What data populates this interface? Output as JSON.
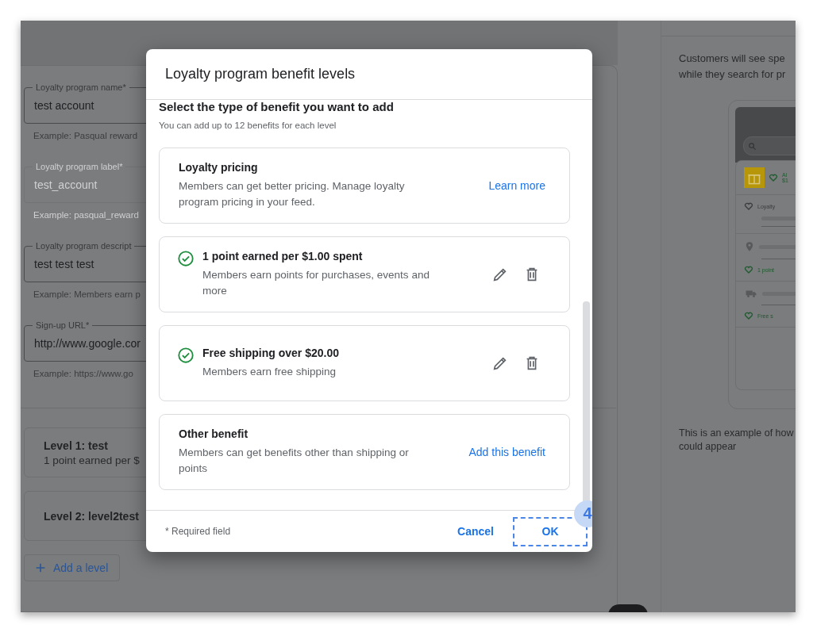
{
  "form": {
    "fields": [
      {
        "label": "Loyalty program name*",
        "value": "test account",
        "hint": "Example: Pasqual reward",
        "disabled": false
      },
      {
        "label": "Loyalty program label*",
        "value": "test_account",
        "hint": "Example: pasqual_reward",
        "disabled": true
      },
      {
        "label": "Loyalty program descript",
        "value": "test test test",
        "hint": "Example: Members earn p",
        "disabled": false
      },
      {
        "label": "Sign-up URL*",
        "value": "http://www.google.cor",
        "hint": "Example: https://www.go",
        "disabled": false
      }
    ],
    "levels": [
      {
        "title": "Level 1: test",
        "subtitle": "1 point earned per $"
      },
      {
        "title": "Level 2: level2test"
      }
    ],
    "add_level": "Add a level"
  },
  "preview": {
    "intro": "Customers will see spe while they search for pr",
    "items": [
      {
        "kind": "gift",
        "text": "Al",
        "subtext": "$1"
      },
      {
        "kind": "loyalty",
        "text": "Loyalty"
      },
      {
        "kind": "place",
        "text": "1 point"
      },
      {
        "kind": "shipping",
        "text": "Free s"
      }
    ],
    "caption": "This is an example of how could appear"
  },
  "dialog": {
    "title": "Loyalty program benefit levels",
    "heading": "Select the type of benefit you want to add",
    "subtitle": "You can add up to 12 benefits for each level",
    "benefits": [
      {
        "kind": "info",
        "title": "Loyalty pricing",
        "description": "Members can get better pricing. Manage loyalty program pricing in your feed.",
        "action": "Learn more"
      },
      {
        "kind": "added",
        "title": "1 point earned per $1.00 spent",
        "description": "Members earn points for purchases, events and more"
      },
      {
        "kind": "added",
        "title": "Free shipping over $20.00",
        "description": "Members earn free shipping"
      },
      {
        "kind": "option",
        "title": "Other benefit",
        "description": "Members can get benefits other than shipping or points",
        "action": "Add this benefit"
      }
    ],
    "footnote": "* Required field",
    "buttons": [
      {
        "label": "Cancel",
        "highlighted": false
      },
      {
        "label": "OK",
        "highlighted": true,
        "badge": "4"
      }
    ]
  }
}
